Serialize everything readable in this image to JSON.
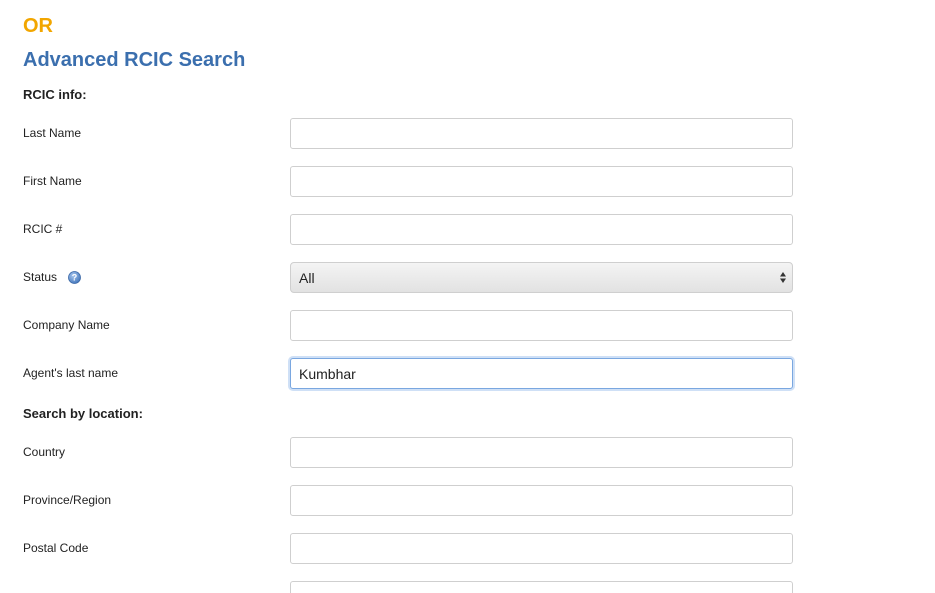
{
  "or_heading": "OR",
  "title": "Advanced RCIC Search",
  "rcic_info": {
    "section_label": "RCIC info:",
    "last_name": {
      "label": "Last Name",
      "value": ""
    },
    "first_name": {
      "label": "First Name",
      "value": ""
    },
    "rcic_number": {
      "label": "RCIC #",
      "value": ""
    },
    "status": {
      "label": "Status",
      "help_icon": "question-mark-icon",
      "selected": "All"
    },
    "company_name": {
      "label": "Company Name",
      "value": ""
    },
    "agent_last_name": {
      "label": "Agent's last name",
      "value": "Kumbhar"
    }
  },
  "location": {
    "section_label": "Search by location:",
    "country": {
      "label": "Country",
      "value": ""
    },
    "province": {
      "label": "Province/Region",
      "value": ""
    },
    "postal_code": {
      "label": "Postal Code",
      "value": ""
    }
  },
  "colors": {
    "or_heading": "#f2a600",
    "title": "#3b6fae",
    "focus_border": "#7aa7e0"
  }
}
